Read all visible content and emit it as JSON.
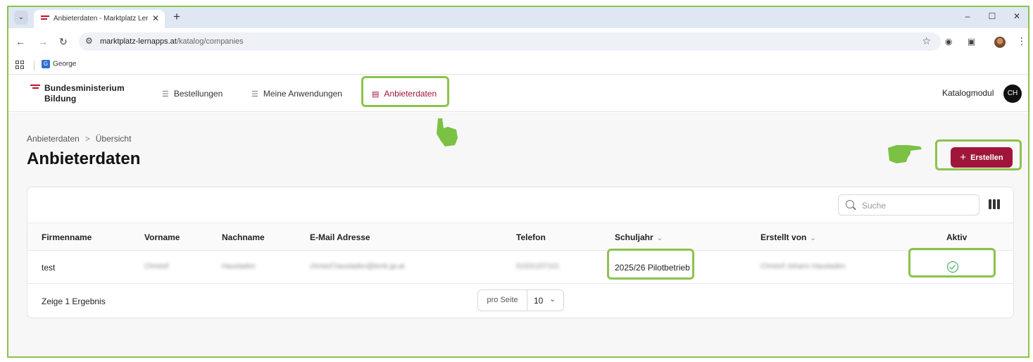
{
  "browser": {
    "tab_title": "Anbieterdaten - Marktplatz Lern",
    "tab_close": "✕",
    "new_tab": "+",
    "url_host": "marktplatz-lernapps.at",
    "url_path": "/katalog/companies",
    "bookmark_label": "George",
    "window_min": "–",
    "window_max": "☐",
    "window_close": "✕"
  },
  "app": {
    "logo_line1": "Bundesministerium",
    "logo_line2": "Bildung",
    "nav": [
      {
        "label": "Bestellungen",
        "icon": "list-icon"
      },
      {
        "label": "Meine Anwendungen",
        "icon": "list-icon"
      },
      {
        "label": "Anbieterdaten",
        "icon": "box-icon",
        "active": true
      }
    ],
    "module_label": "Katalogmodul",
    "user_initials": "CH"
  },
  "page": {
    "breadcrumb": [
      "Anbieterdaten",
      "Übersicht"
    ],
    "title": "Anbieterdaten",
    "create_label": "Erstellen"
  },
  "table": {
    "search_placeholder": "Suche",
    "columns": [
      "Firmenname",
      "Vorname",
      "Nachname",
      "E-Mail Adresse",
      "Telefon",
      "Schuljahr",
      "Erstellt von",
      "Aktiv"
    ],
    "rows": [
      {
        "firmenname": "test",
        "vorname": "Christof",
        "nachname": "Hausladen",
        "email": "christof.hausladen@bmb.gv.at",
        "telefon": "01531207101",
        "schuljahr": "2025/26 Pilotbetrieb",
        "erstellt_von": "Christof Johann Hausladen",
        "aktiv": true
      }
    ],
    "result_text": "Zeige 1 Ergebnis",
    "per_page_label": "pro Seite",
    "per_page_value": "10"
  },
  "colors": {
    "accent": "#a0163a",
    "highlight": "#8cc34b",
    "brand_red": "#c8102e"
  }
}
